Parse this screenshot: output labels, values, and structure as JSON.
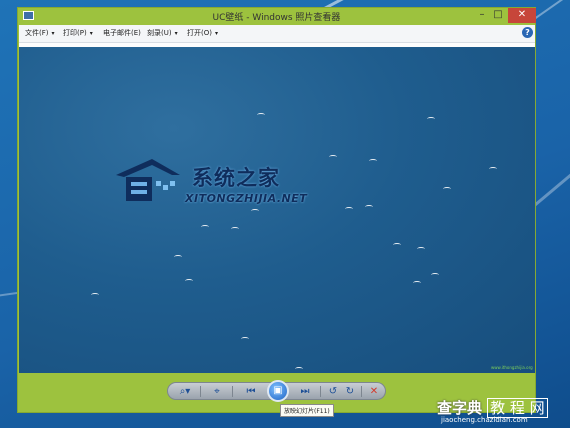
{
  "window": {
    "title": "UC壁纸 - Windows 照片查看器",
    "controls": {
      "minimize": "–",
      "maximize": "□",
      "close": "✕"
    }
  },
  "menu": {
    "items": [
      {
        "label": "文件(F)",
        "arrow": "▾"
      },
      {
        "label": "打印(P)",
        "arrow": "▾"
      },
      {
        "label": "电子邮件(E)",
        "arrow": ""
      },
      {
        "label": "刻录(U)",
        "arrow": "▾"
      },
      {
        "label": "打开(O)",
        "arrow": "▾"
      }
    ],
    "help": "?"
  },
  "photo": {
    "logo_cn": "系统之家",
    "logo_en": "XITONGZHIJIA.NET",
    "caption": "www.ithongzhijia.org"
  },
  "controls": {
    "zoom": "⌕▾",
    "fit": "⌖",
    "prev": "⏮",
    "play": "▣",
    "next": "⏭",
    "rotate_ccw": "↺",
    "rotate_cw": "↻",
    "delete": "✕",
    "tooltip": "放映幻灯片(F11)"
  },
  "watermark": {
    "main": "查字典",
    "sub": "教 程 网",
    "url": "jiaocheng.chazidian.com"
  },
  "colors": {
    "window_frame": "#9dc23e",
    "close_button": "#c7463a",
    "photo_sea": "#1f5d8e",
    "desktop": "#1a63a8"
  }
}
